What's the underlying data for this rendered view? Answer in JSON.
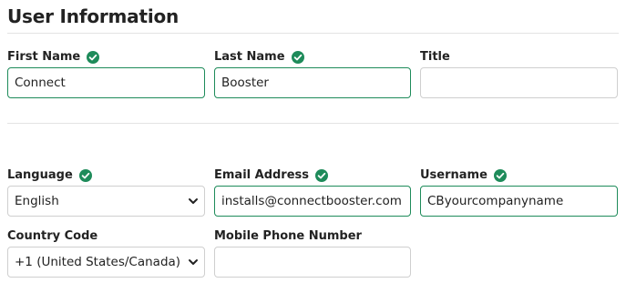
{
  "section": {
    "title": "User Information"
  },
  "fields": {
    "first_name": {
      "label": "First Name",
      "value": "Connect",
      "valid": true
    },
    "last_name": {
      "label": "Last Name",
      "value": "Booster",
      "valid": true
    },
    "title": {
      "label": "Title",
      "value": ""
    },
    "language": {
      "label": "Language",
      "value": "English",
      "valid": true
    },
    "email": {
      "label": "Email Address",
      "value": "installs@connectbooster.com",
      "valid": true
    },
    "username": {
      "label": "Username",
      "value": "CByourcompanyname",
      "valid": true
    },
    "country_code": {
      "label": "Country Code",
      "value": "+1 (United States/Canada)"
    },
    "mobile": {
      "label": "Mobile Phone Number",
      "value": ""
    }
  },
  "colors": {
    "valid": "#1e8b5a",
    "border": "#cfcfcf",
    "divider": "#e3e3e3"
  },
  "icons": {
    "valid_indicator": "check-circle-icon",
    "dropdown": "chevron-down-icon"
  }
}
